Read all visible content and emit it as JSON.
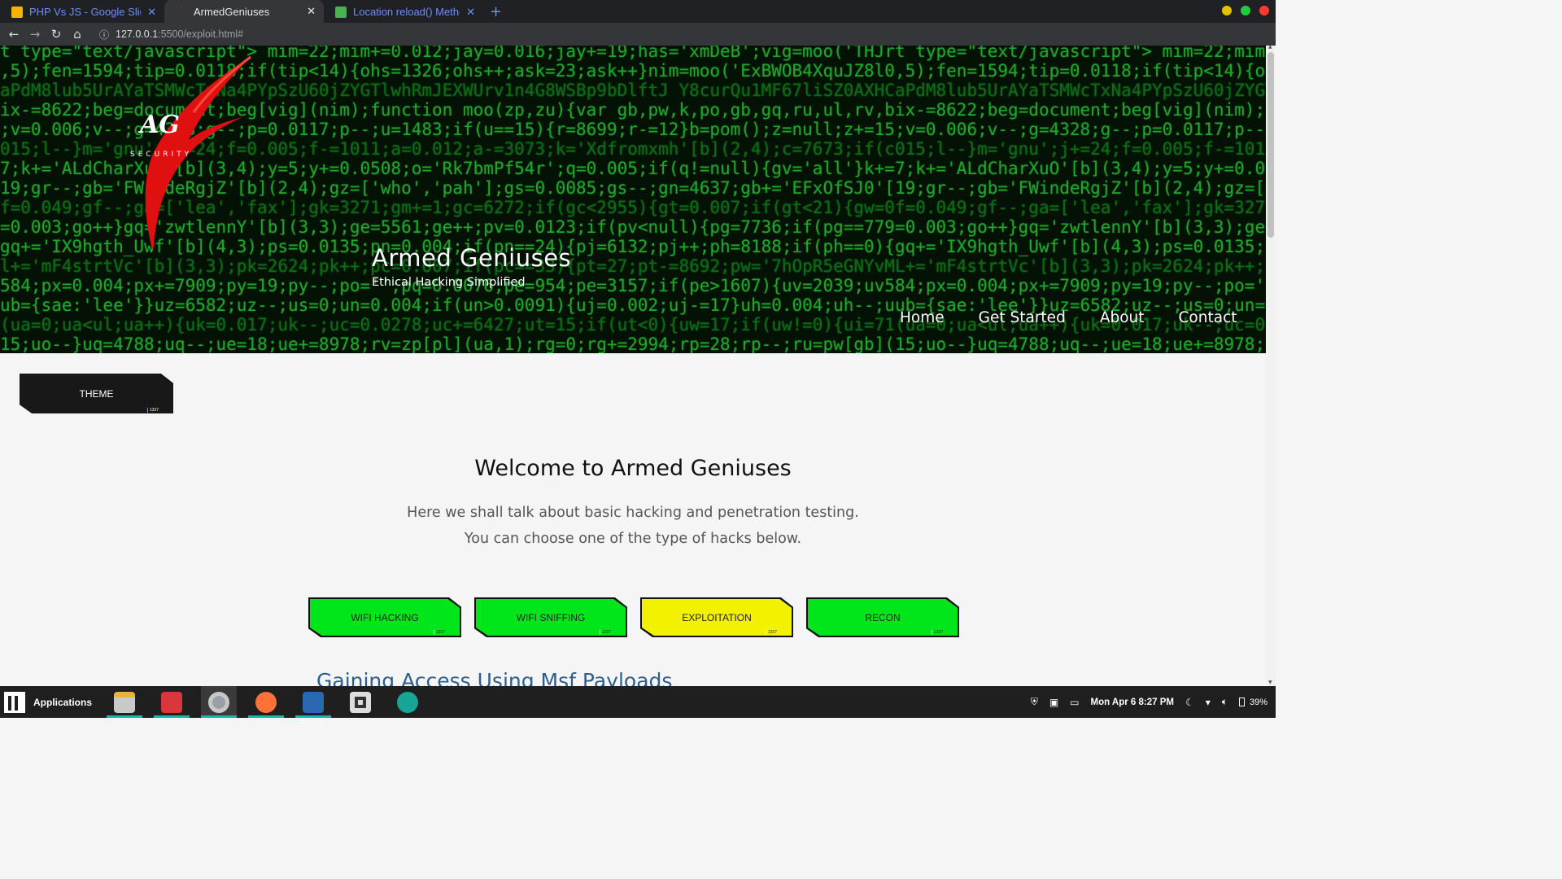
{
  "browser": {
    "tabs": [
      {
        "title": "PHP Vs JS - Google Slides",
        "icon": "google-slides-icon",
        "active": false
      },
      {
        "title": "ArmedGeniuses",
        "icon": "site-favicon",
        "active": true
      },
      {
        "title": "Location reload() Method",
        "icon": "w3schools-icon",
        "active": false
      }
    ],
    "url_host": "127.0.0.1",
    "url_path": ":5500/exploit.html#"
  },
  "hero": {
    "code_lines": [
      "t type=\"text/javascript\"> mim=22;mim+=0.012;jay=0.016;jay+=19;has='xmDeB';vig=moo('THJrt type=\"text/javascript\"> mim=22;mim+=0.012",
      ",5);fen=1594;tip=0.0118;if(tip<14){ohs=1326;ohs++;ask=23;ask++}nim=moo('ExBWOB4XquJZ8l0,5);fen=1594;tip=0.0118;if(tip<14){ohs=1326",
      "aPdM8lub5UrAYaTSMWcTxNa4PYpSzU60jZYGTlwhRmJEXWUrv1n4G8WSBp9bDlftJ Y8curQu1MF67liSZ0AXHCaPdM8lub5UrAYaTSMWcTxNa4PYpSzU60jZYGTlwhRmJ",
      "ix-=8622;beg=document;beg[vig](nim);function moo(zp,zu){var gb,pw,k,po,gb,gq,ru,ul,rv,bix-=8622;beg=document;beg[vig](nim);functio",
      ";v=0.006;v--;g=4328;g--;p=0.0117;p--;u=1483;if(u==15){r=8699;r-=12}b=pom();z=null;z+=15;v=0.006;v--;g=4328;g--;p=0.0117;p--;u=1483",
      "015;l--}m='gnu';j+=24;f=0.005;f-=1011;a=0.012;a-=3073;k='Xdfromxmh'[b](2,4);c=7673;if(c015;l--}m='gnu';j+=24;f=0.005;f-=1011;a=0.0",
      "7;k+='ALdCharXuO'[b](3,4);y=5;y+=0.0508;o='Rk7bmPf54r';q=0.005;if(q!=null){gv='all'}k+=7;k+='ALdCharXuO'[b](3,4);y=5;y+=0.0508;o=",
      "19;gr--;gb='FWindeRgjZ'[b](2,4);gz=['who','pah'];gs=0.0085;gs--;gn=4637;gb+='EFxOfSJ0'[19;gr--;gb='FWindeRgjZ'[b](2,4);gz=['who',",
      "f=0.049;gf--;ga=['lea','fax'];gk=3271;gm+=1;gc=6272;if(gc<2955){gt=0.007;if(gt<21){gw=0f=0.049;gf--;ga=['lea','fax'];gk=3271;gm+=1",
      "=0.003;go++}gq='zwtlennY'[b](3,3);ge=5561;ge++;pv=0.0123;if(pv<null){pg=7736;if(pg==779=0.003;go++}gq='zwtlennY'[b](3,3);ge=5561;",
      "gq+='IX9hgth_Uwf'[b](4,3);ps=0.0135;pn=0.004;if(pn==24){pj=6132;pj++;ph=8188;if(ph==0){gq+='IX9hgth_Uwf'[b](4,3);ps=0.0135;pn=0.00",
      "l+='mF4strtVc'[b](3,3);pk=2624;pk++;pc=0.007;if(pc==33){pt=27;pt-=8692;pw='7hOpR5eGNYvML+='mF4strtVc'[b](3,3);pk=2624;pk++;pc=0.0",
      "584;px=0.004;px+=7909;py=19;py--;po='';pq=0.0076;pe=954;pe=3157;if(pe>1607){uv=2039;uv584;px=0.004;px+=7909;py=19;py--;po='';pq=0",
      "ub={sae:'lee'}}uz=6582;uz--;us=0;un=0.004;if(un>0.0091){uj=0.002;uj-=17}uh=0.004;uh--;uub={sae:'lee'}}uz=6582;uz--;us=0;un=0.004;",
      "(ua=0;ua<ul;ua++){uk=0.017;uk--;uc=0.0278;uc+=6427;ut=15;if(ut<0){uw=17;if(uw!=0){ui=71(ua=0;ua<ul;ua++){uk=0.017;uk--;uc=0.0278;u",
      "15;uo--}uq=4788;uq--;ue=18;ue+=8978;rv=zp[pl](ua,1);rg=0;rg+=2994;rp=28;rp--;ru=pw[gb](15;uo--}uq=4788;uq--;ue=18;ue+=8978;rv=zp[pl"
    ],
    "logo_text": "AG",
    "logo_sub": "SECURITY",
    "site_title": "Armed Geniuses",
    "site_tagline": "Ethical Hacking Simplified",
    "nav": [
      "Home",
      "Get Started",
      "About",
      "Contact"
    ]
  },
  "theme_button": {
    "label": "THEME",
    "badge": "1337"
  },
  "main": {
    "heading": "Welcome to Armed Geniuses",
    "intro_lines": [
      "Here we shall talk about basic hacking and penetration testing.",
      "You can choose one of the type of hacks below."
    ],
    "hack_buttons": [
      {
        "label": "WIFI HACKING",
        "color": "#00e61b",
        "badge": "1337"
      },
      {
        "label": "WIFI SNIFFING",
        "color": "#00e61b",
        "badge": "1337"
      },
      {
        "label": "EXPLOITATION",
        "color": "#f2f200",
        "badge": "1337"
      },
      {
        "label": "RECON",
        "color": "#00e61b",
        "badge": "1337"
      }
    ],
    "next_section_title": "Gaining Access Using Msf Payloads"
  },
  "taskbar": {
    "apps_label": "Applications",
    "apps": [
      "file-manager-icon",
      "red-app-icon",
      "chrome-icon",
      "firefox-icon",
      "text-editor-icon",
      "audio-player-icon",
      "camera-icon"
    ],
    "clock": "Mon Apr 6  8:27 PM",
    "battery": "39%"
  },
  "colors": {
    "accent_green": "#00e61b",
    "accent_yellow": "#f2f200",
    "matrix_green": "#22a52e",
    "link_blue": "#2c5e8f"
  }
}
